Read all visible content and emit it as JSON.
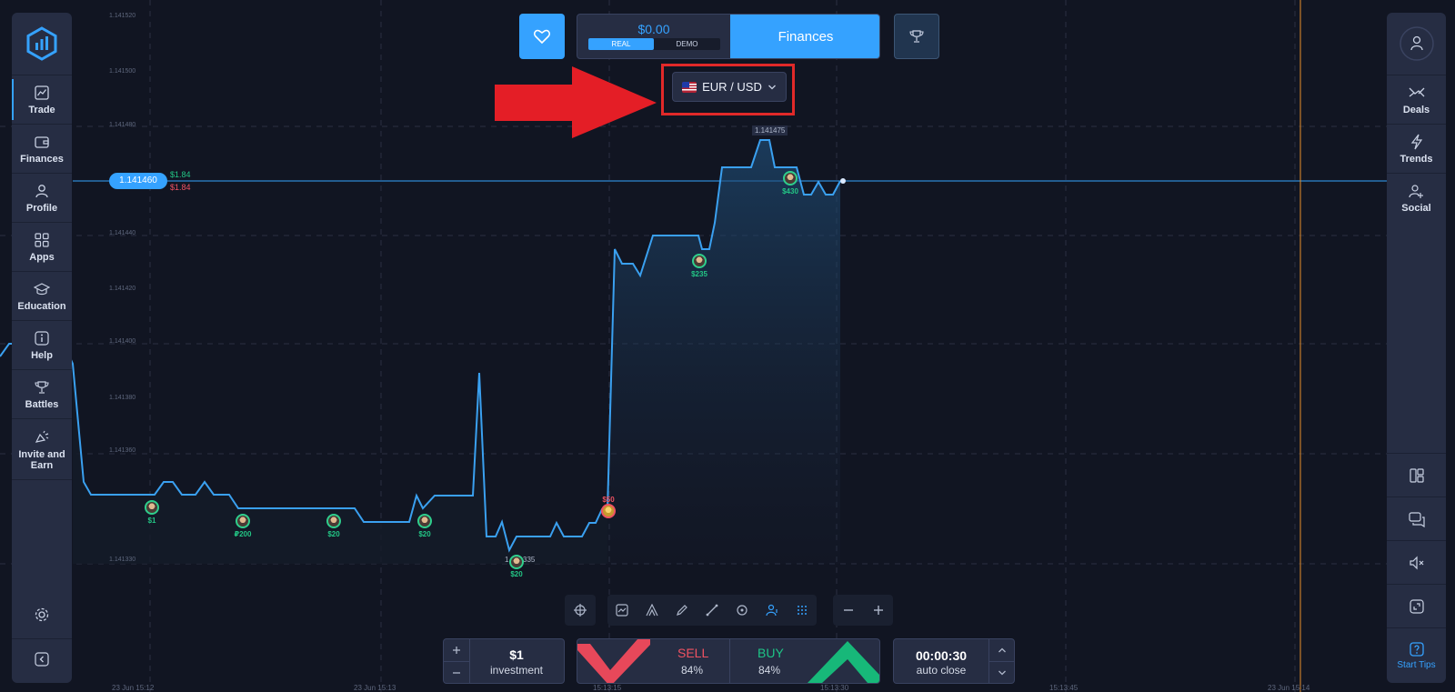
{
  "sidebar": {
    "items": [
      {
        "label": "Trade",
        "icon": "chart-line-icon",
        "active": true
      },
      {
        "label": "Finances",
        "icon": "wallet-icon"
      },
      {
        "label": "Profile",
        "icon": "user-icon"
      },
      {
        "label": "Apps",
        "icon": "apps-grid-icon"
      },
      {
        "label": "Education",
        "icon": "graduation-cap-icon"
      },
      {
        "label": "Help",
        "icon": "info-icon"
      },
      {
        "label": "Battles",
        "icon": "trophy-icon"
      },
      {
        "label": "Invite and Earn",
        "icon": "megaphone-icon"
      }
    ]
  },
  "right_sidebar": {
    "items": [
      {
        "label": "Deals",
        "icon": "deals-icon"
      },
      {
        "label": "Trends",
        "icon": "lightning-icon"
      },
      {
        "label": "Social",
        "icon": "add-user-icon"
      }
    ],
    "start_tips": "Start Tips"
  },
  "header": {
    "balance": "$0.00",
    "mode_real": "REAL",
    "mode_demo": "DEMO",
    "finances": "Finances"
  },
  "asset": {
    "pair": "EUR / USD"
  },
  "chart": {
    "current_price": "1.141460",
    "pnl_up": "$1.84",
    "pnl_down": "$1.84",
    "peak_label": "1.141475",
    "low_label": "1.141335",
    "y_labels": [
      "1.141520",
      "1.141500",
      "1.141480",
      "1.141460",
      "1.141440",
      "1.141420",
      "1.141400",
      "1.141380",
      "1.141360",
      "1.141330"
    ],
    "x_labels": [
      "23 Jun 15:12",
      "23 Jun 15:13",
      "15:13:15",
      "15:13:30",
      "15:13:45",
      "23 Jun 15:14"
    ],
    "traders": [
      {
        "amount": "$1",
        "color": "green"
      },
      {
        "amount": "₽200",
        "color": "green"
      },
      {
        "amount": "$20",
        "color": "green"
      },
      {
        "amount": "$20",
        "color": "green"
      },
      {
        "amount": "$20",
        "color": "green"
      },
      {
        "amount": "$50",
        "color": "red"
      },
      {
        "amount": "$235",
        "color": "green"
      },
      {
        "amount": "$430",
        "color": "green"
      }
    ]
  },
  "trade_panel": {
    "investment_value": "$1",
    "investment_label": "investment",
    "sell_label": "SELL",
    "sell_pct": "84%",
    "buy_label": "BUY",
    "buy_pct": "84%",
    "timer_value": "00:00:30",
    "timer_label": "auto close"
  },
  "colors": {
    "accent": "#35a2ff",
    "sell": "#f05262",
    "buy": "#1ec486",
    "background": "#111522",
    "panel": "#262d43"
  }
}
